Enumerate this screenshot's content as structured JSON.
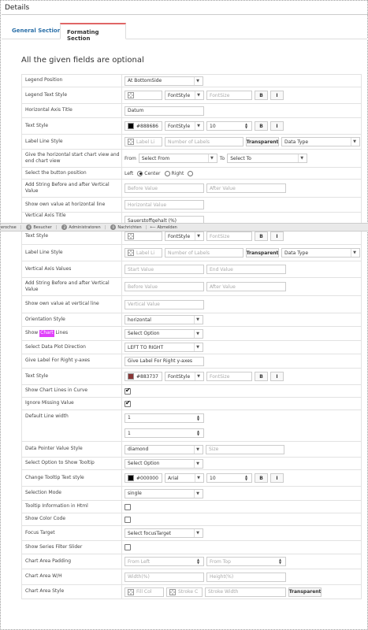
{
  "window": {
    "title": "Details"
  },
  "tabs": [
    {
      "label": "General Section"
    },
    {
      "label": "Formating Section"
    }
  ],
  "heading": "All the given fields are optional",
  "statusbar": {
    "partial": "erochse",
    "visitors_count": "6",
    "visitors_label": "Besucher",
    "admins_count": "2",
    "admins_label": "Administratoren",
    "messages_count": "0",
    "messages_label": "Nachrichten",
    "logout_label": "Abmelden"
  },
  "rows": {
    "legend_position": {
      "label": "Legend Position",
      "value": "At BottomSide"
    },
    "legend_text_style": {
      "label": "Legend Text Style",
      "font_style": "FontStyle",
      "font_size_ph": "FontSize",
      "bold": "B",
      "italic": "I"
    },
    "h_axis_title": {
      "label": "Horizontal Axis Title",
      "value": "Datum"
    },
    "text_style_1": {
      "label": "Text Style",
      "color_hex": "#888686",
      "color": "#000000",
      "font_style": "FontStyle",
      "size": "10",
      "bold": "B",
      "italic": "I"
    },
    "label_line_style_1": {
      "label": "Label Line Style",
      "label_ph": "Label Li",
      "num_labels_ph": "Number of Labels",
      "transparent": "Transparent",
      "data_type": "Data Type"
    },
    "start_chart_view": {
      "label": "Give the horizontal start chart view and end chart view",
      "from": "From",
      "from_sel": "Select From",
      "to": "To",
      "to_sel": "Select To"
    },
    "button_position": {
      "label": "Select the button position",
      "left": "Left",
      "center": "Center",
      "right": "Right"
    },
    "add_string_h": {
      "label": "Add String Before and after Vertical Value",
      "before_ph": "Before Value",
      "after_ph": "After Value"
    },
    "own_value_h": {
      "label": "Show own value at horizontal line",
      "ph": "Horizontal Value"
    },
    "v_axis_title": {
      "label": "Vertical Axis Title",
      "value": "Sauerstoffgehalt (%)"
    },
    "text_style_2": {
      "label": "Text Style",
      "font_style": "FontStyle",
      "font_size_ph": "FontSize",
      "bold": "B",
      "italic": "I"
    },
    "label_line_style_2": {
      "label": "Label Line Style",
      "label_ph": "Label Li",
      "num_labels_ph": "Number of Labels",
      "transparent": "Transparent",
      "data_type": "Data Type"
    },
    "v_axis_values": {
      "label": "Vertical Axis Values",
      "start_ph": "Start Value",
      "end_ph": "End Value"
    },
    "add_string_v": {
      "label": "Add String Before and after Vertical Value",
      "before_ph": "Before Value",
      "after_ph": "After Value"
    },
    "own_value_v": {
      "label": "Show own value at vertical line",
      "ph": "Vertical Value"
    },
    "orientation": {
      "label": "Orientation Style",
      "value": "horizontal"
    },
    "show_lines": {
      "label_pre": "Show",
      "label_hl": "Chart",
      "label_post": "Lines",
      "value": "Select Option"
    },
    "data_plot_dir": {
      "label": "Select Data Plot Direction",
      "value": "LEFT TO RIGHT"
    },
    "right_y_label": {
      "label": "Give Label For Right y-axes",
      "value": "Give Label For Right y-axes"
    },
    "text_style_3": {
      "label": "Text Style",
      "color_hex": "#883737",
      "color": "#883737",
      "font_style": "FontStyle",
      "font_size_ph": "FontSize",
      "bold": "B",
      "italic": "I"
    },
    "chart_lines_curve": {
      "label": "Show Chart Lines in Curve",
      "checked": true
    },
    "ignore_missing": {
      "label": "Ignore Missing Value",
      "checked": true
    },
    "default_line_width": {
      "label": "Default Line width",
      "value1": "1",
      "value2": "1"
    },
    "pointer_style": {
      "label": "Data Pointer Value Style",
      "value": "diamond",
      "size_ph": "Size"
    },
    "tooltip_option": {
      "label": "Select Option to Show Tooltip",
      "value": "Select Option"
    },
    "tooltip_text_style": {
      "label": "Change Tooltip Text style",
      "color_hex": "#000000",
      "color": "#000000",
      "font": "Arial",
      "size": "10",
      "bold": "B",
      "italic": "I"
    },
    "selection_mode": {
      "label": "Selection Mode",
      "value": "single"
    },
    "tooltip_html": {
      "label": "Tooltip Information in Html",
      "checked": false
    },
    "show_color_code": {
      "label": "Show Color Code",
      "checked": false
    },
    "focus_target": {
      "label": "Focus Target",
      "value": "Select focusTarget"
    },
    "series_filter": {
      "label": "Show Series Filter Slider",
      "checked": false
    },
    "chart_padding": {
      "label": "Chart Area Padding",
      "left_ph": "From Left",
      "top_ph": "From Top"
    },
    "chart_wh": {
      "label": "Chart Area W/H",
      "width_ph": "Width(%)",
      "height_ph": "Height(%)"
    },
    "chart_area_style": {
      "label": "Chart Area Style",
      "fill_ph": "Fill Col",
      "stroke_ph": "Stroke C",
      "stroke_width_ph": "Stroke Width",
      "transparent": "Transparent"
    }
  }
}
